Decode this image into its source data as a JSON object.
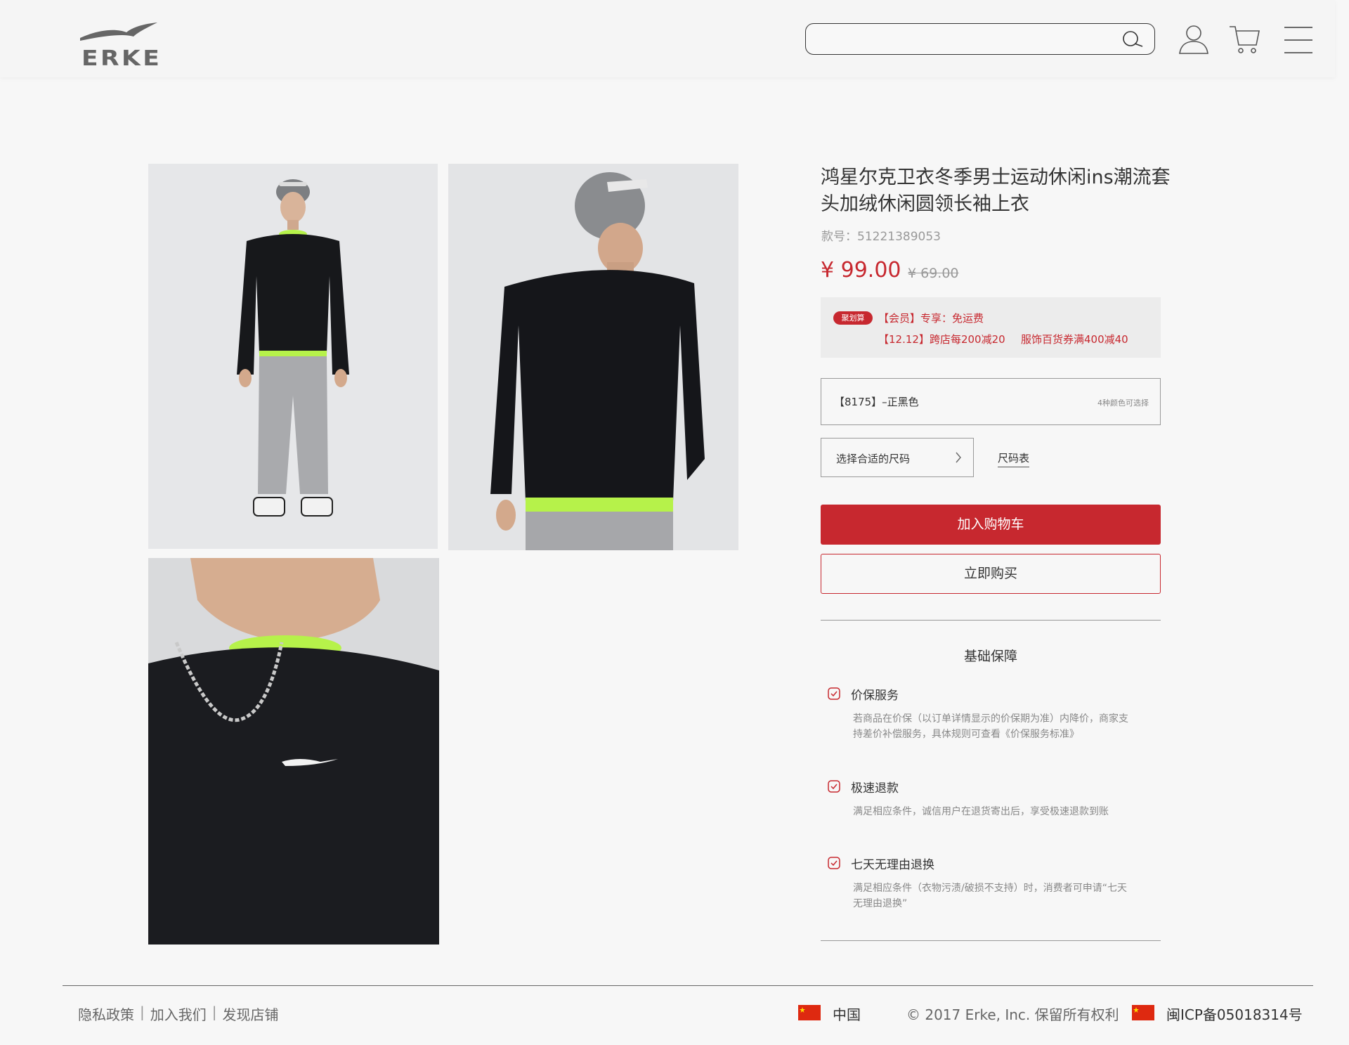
{
  "brand": {
    "logo_text": "ERKE"
  },
  "header": {
    "search_placeholder": ""
  },
  "product": {
    "title": "鸿星尔克卫衣冬季男士运动休闲ins潮流套头加绒休闲圆领长袖上衣",
    "sku": "款号：51221389053",
    "price": "¥ 99.00",
    "original_price": "¥ 69.00"
  },
  "promotions": {
    "badge": "聚划算",
    "line1": "【会员】专享：免运费",
    "line2": "【12.12】跨店每200减20",
    "line3": "服饰百货券满400减40"
  },
  "color_select": {
    "label": "【8175】–正黑色",
    "count": "4种颜色可选择"
  },
  "size_select": {
    "label": "选择合适的尺码",
    "chart_link": "尺码表"
  },
  "buttons": {
    "add_to_cart": "加入购物车",
    "buy_now": "立即购买"
  },
  "guarantees": {
    "title": "基础保障",
    "items": [
      {
        "name": "价保服务",
        "desc": "若商品在价保（以订单详情显示的价保期为准）内降价，商家支持差价补偿服务，具体规则可查看《价保服务标准》"
      },
      {
        "name": "极速退款",
        "desc": "满足相应条件，诚信用户在退货寄出后，享受极速退款到账"
      },
      {
        "name": "七天无理由退换",
        "desc": "满足相应条件（衣物污渍/破损不支持）时，消费者可申请“七天无理由退换”"
      }
    ]
  },
  "footer": {
    "links": [
      "隐私政策",
      "加入我们",
      "发现店铺"
    ],
    "country": "中国",
    "copyright": "© 2017 Erke, Inc. 保留所有权利",
    "icp": "闽ICP备05018314号"
  },
  "colors": {
    "accent": "#c7282f",
    "background": "#f7f7f7"
  }
}
